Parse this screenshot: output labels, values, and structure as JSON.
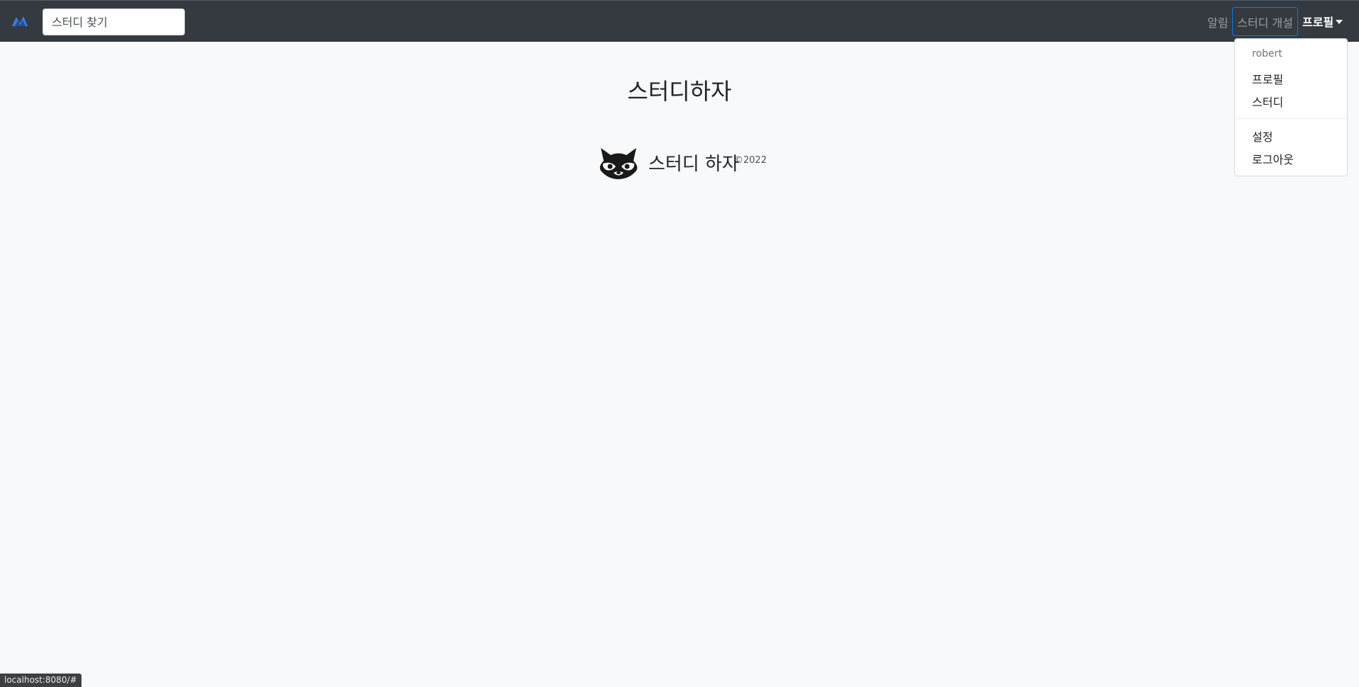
{
  "navbar": {
    "brand_icon": "mountain-logo-icon",
    "search": {
      "placeholder": "스터디 찾기",
      "value": ""
    },
    "notifications_label": "알림",
    "create_study_label": "스터디 개설",
    "profile_label": "프로필",
    "accent_color": "#007bff",
    "background_color": "#343a40"
  },
  "profile_menu": {
    "username": "robert",
    "items": [
      "프로필",
      "스터디",
      "설정",
      "로그아웃"
    ]
  },
  "main": {
    "title": "스터디하자"
  },
  "footer": {
    "logo_icon": "raccoon-logo-icon",
    "name": "스터디 하자",
    "copyright": "©2022"
  },
  "status_url": "localhost:8080/#"
}
